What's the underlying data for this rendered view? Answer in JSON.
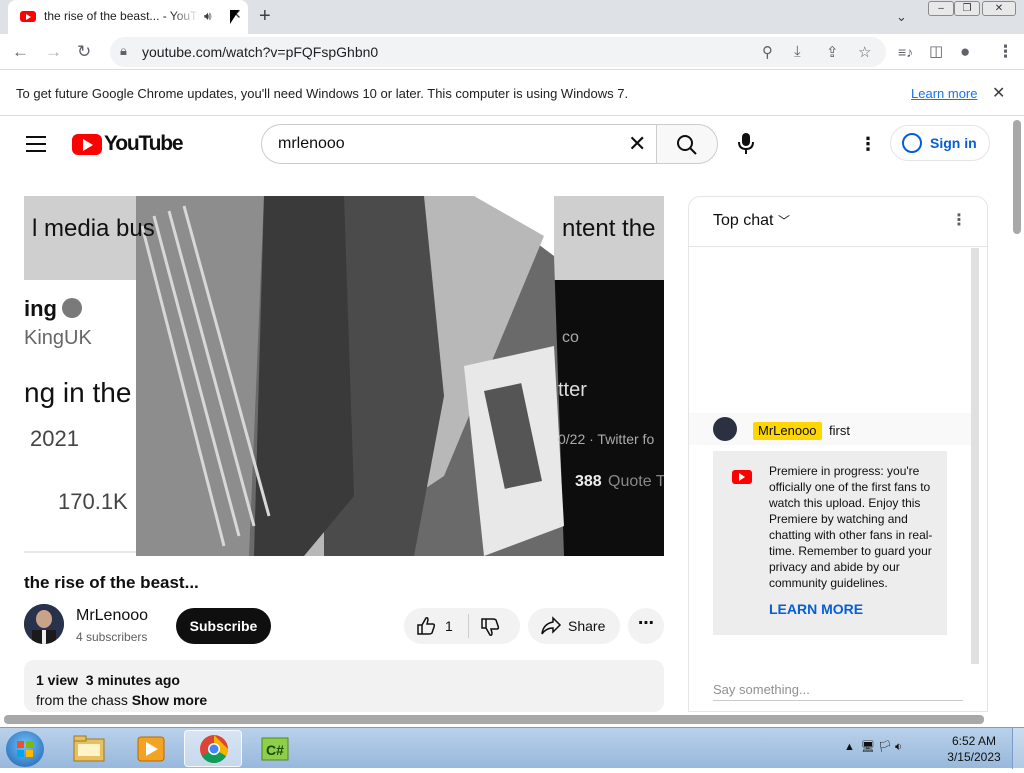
{
  "browser": {
    "tab_title": "the rise of the beast... - YouTube",
    "url": "youtube.com/watch?v=pFQFspGhbn0",
    "infobar_text": "To get future Google Chrome updates, you'll need Windows 10 or later. This computer is using Windows 7.",
    "infobar_link": "Learn more",
    "icons": [
      "back-icon",
      "forward-icon",
      "reload-icon",
      "lock-icon",
      "zoom-icon",
      "install-icon",
      "share-icon",
      "bookmark-star-icon",
      "media-icon",
      "sidepanel-icon",
      "profile-icon",
      "menu-icon"
    ]
  },
  "youtube": {
    "logo_text": "YouTube",
    "search_value": "mrlenooo",
    "signin_label": "Sign in"
  },
  "video": {
    "title": "the rise of the beast...",
    "channel_name": "MrLenooo",
    "subscribers": "4 subscribers",
    "subscribe_label": "Subscribe",
    "like_count": "1",
    "share_label": "Share",
    "description_stats": "1 view  3 minutes ago",
    "description_text": "from the chass",
    "show_more": "Show more",
    "frame_text": {
      "top_left": "l media bus",
      "top_right": "ntent the",
      "handle_a": "ing",
      "handle_b": "KingUK",
      "line": "ng in the",
      "year": "2021",
      "count": "170.1K",
      "handle_c": "co",
      "word": "tter",
      "date": "0/22 · Twitter fo",
      "quote_num": "388",
      "quote_lbl": "Quote T"
    }
  },
  "chat": {
    "header": "Top chat",
    "message_author": "MrLenooo",
    "message_text": "first",
    "banner_text": "Premiere in progress: you're officially one of the first fans to watch this upload. Enjoy this Premiere by watching and chatting with other fans in real-time. Remember to guard your privacy and abide by our community guidelines.",
    "banner_link": "LEARN MORE",
    "input_placeholder": "Say something..."
  },
  "taskbar": {
    "time": "6:52 AM",
    "date": "3/15/2023",
    "apps": [
      "explorer-icon",
      "media-player-icon",
      "chrome-icon",
      "csharp-icon"
    ]
  }
}
